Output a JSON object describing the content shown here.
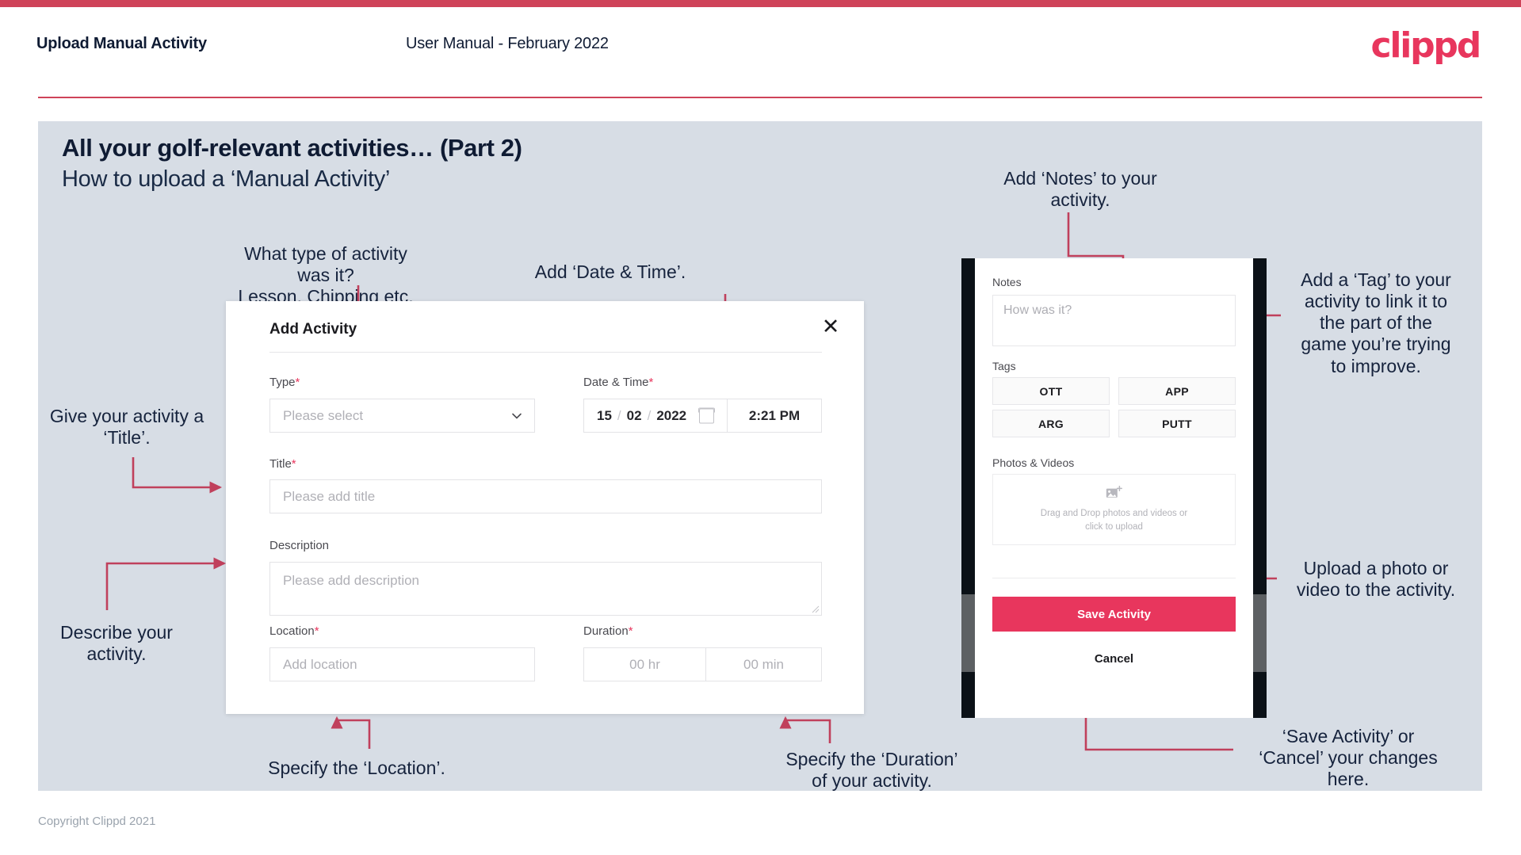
{
  "brand": {
    "logo_text": "clippd",
    "accent": "#e8365d",
    "bar": "#cf4359",
    "slide_bg": "#d7dde5",
    "ink": "#0f1b33"
  },
  "header": {
    "title": "Upload Manual Activity",
    "subtitle": "User Manual - February 2022"
  },
  "slide": {
    "title": "All your golf-relevant activities… (Part 2)",
    "subtitle": "How to upload a ‘Manual Activity’"
  },
  "footer": {
    "copyright": "Copyright Clippd 2021"
  },
  "annotations": {
    "type": "What type of activity was it?\nLesson, Chipping etc.",
    "datetime": "Add ‘Date & Time’.",
    "title": "Give your activity a\n‘Title’.",
    "description": "Describe your\nactivity.",
    "location": "Specify the ‘Location’.",
    "duration": "Specify the ‘Duration’\nof your activity.",
    "notes": "Add ‘Notes’ to your\nactivity.",
    "tags": "Add a ‘Tag’ to your\nactivity to link it to\nthe part of the\ngame you’re trying\nto improve.",
    "upload": "Upload a photo or\nvideo to the activity.",
    "save": "‘Save Activity’ or\n‘Cancel’ your changes\nhere."
  },
  "dialog": {
    "title": "Add Activity",
    "close_icon": "✕",
    "fields": {
      "type": {
        "label": "Type",
        "required": "*",
        "placeholder": "Please select",
        "value": ""
      },
      "datetime": {
        "label": "Date & Time",
        "required": "*",
        "day": "15",
        "sep1": "/",
        "month": "02",
        "sep2": "/",
        "year": "2022",
        "time": "2:21 PM"
      },
      "title": {
        "label": "Title",
        "required": "*",
        "placeholder": "Please add title",
        "value": ""
      },
      "description": {
        "label": "Description",
        "required": "",
        "placeholder": "Please add description",
        "value": ""
      },
      "location": {
        "label": "Location",
        "required": "*",
        "placeholder": "Add location",
        "value": ""
      },
      "duration": {
        "label": "Duration",
        "required": "*",
        "hours_placeholder": "00 hr",
        "minutes_placeholder": "00 min"
      }
    }
  },
  "phone": {
    "notes": {
      "label": "Notes",
      "placeholder": "How was it?"
    },
    "tags": {
      "label": "Tags",
      "items": [
        "OTT",
        "APP",
        "ARG",
        "PUTT"
      ]
    },
    "photos": {
      "label": "Photos & Videos",
      "dropzone_line1": "Drag and Drop photos and videos or",
      "dropzone_line2": "click to upload",
      "icon": "add-image-icon"
    },
    "buttons": {
      "save": "Save Activity",
      "cancel": "Cancel"
    }
  }
}
